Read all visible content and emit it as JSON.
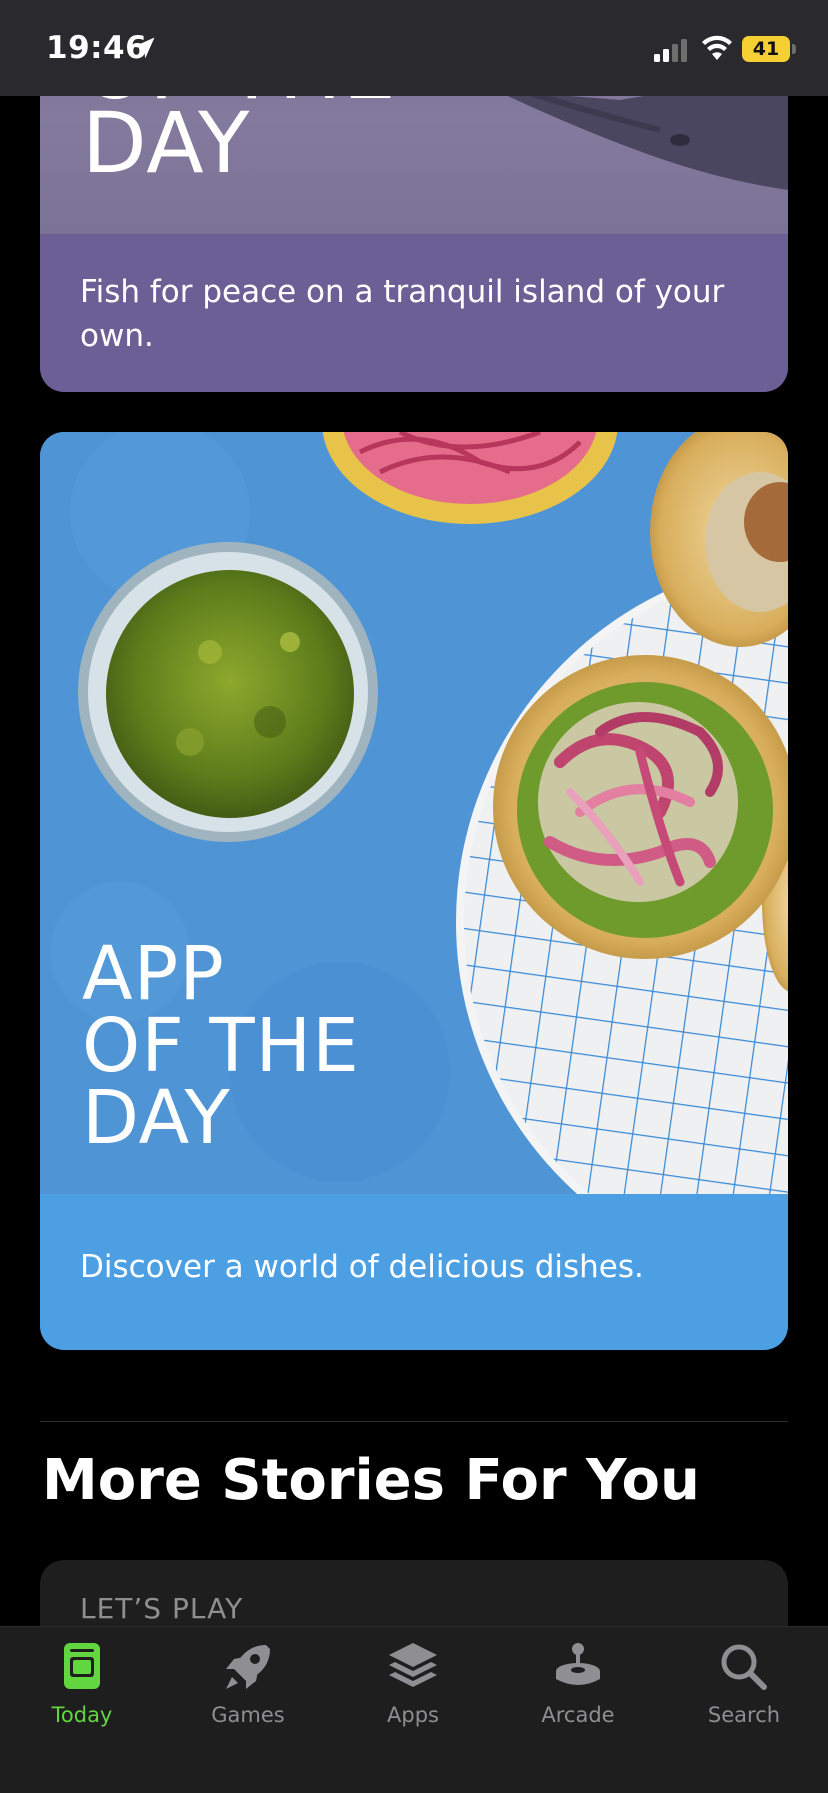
{
  "status_bar": {
    "time": "19:46",
    "battery": "41"
  },
  "cards": {
    "fish": {
      "title_partial": "OF THE\nDAY",
      "description": "Fish for peace on a tranquil island of your own."
    },
    "food": {
      "title": "APP\nOF THE\nDAY",
      "description": "Discover a world of delicious dishes."
    }
  },
  "section": {
    "heading": "More Stories For You"
  },
  "story_card": {
    "kicker": "LET’S PLAY"
  },
  "tab_bar": {
    "tabs": [
      {
        "label": "Today",
        "icon": "today-icon",
        "active": true
      },
      {
        "label": "Games",
        "icon": "rocket-icon",
        "active": false
      },
      {
        "label": "Apps",
        "icon": "layers-icon",
        "active": false
      },
      {
        "label": "Arcade",
        "icon": "joystick-icon",
        "active": false
      },
      {
        "label": "Search",
        "icon": "search-icon",
        "active": false
      }
    ]
  },
  "colors": {
    "active_tab": "#61d63f",
    "inactive_tab": "#8e8e93",
    "fish_card": "#6c5f96",
    "food_card": "#4d9fe3",
    "battery": "#f5cf33"
  }
}
